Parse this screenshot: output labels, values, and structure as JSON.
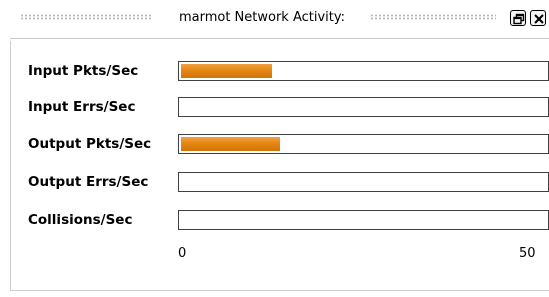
{
  "window": {
    "title": "marmot Network Activity:",
    "buttons": {
      "restore": "restore-icon",
      "close": "close-icon"
    }
  },
  "meters": [
    {
      "label": "Input Pkts/Sec",
      "value": 12.5
    },
    {
      "label": "Input Errs/Sec",
      "value": 0
    },
    {
      "label": "Output Pkts/Sec",
      "value": 13.5
    },
    {
      "label": "Output Errs/Sec",
      "value": 0
    },
    {
      "label": "Collisions/Sec",
      "value": 0
    }
  ],
  "scale": {
    "min": "0",
    "max": "50",
    "min_value": 0,
    "max_value": 50
  },
  "colors": {
    "bar_fill": "#e58712",
    "bar_border": "#404040"
  }
}
